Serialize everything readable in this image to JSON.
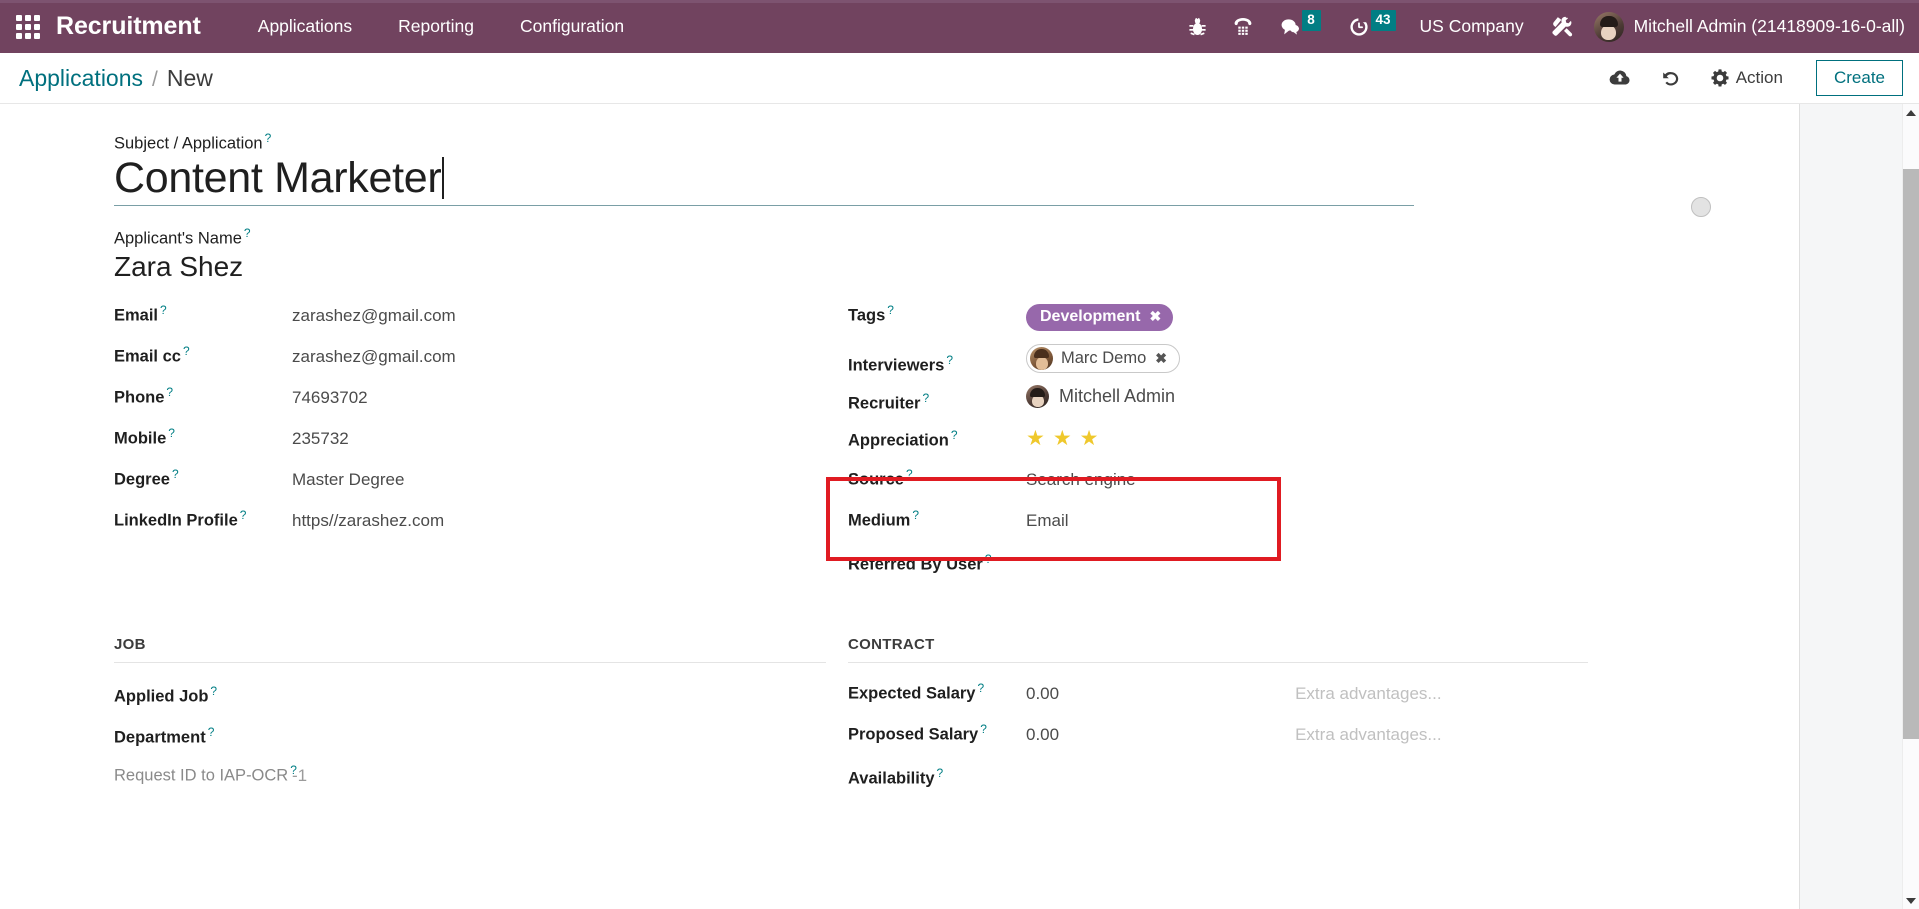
{
  "navbar": {
    "apps_icon": "apps-grid-icon",
    "brand": "Recruitment",
    "menus": [
      {
        "label": "Applications"
      },
      {
        "label": "Reporting"
      },
      {
        "label": "Configuration"
      }
    ],
    "sys_icons": [
      {
        "name": "bug-icon",
        "badge": null
      },
      {
        "name": "phone-dialpad-icon",
        "badge": null
      },
      {
        "name": "messages-icon",
        "badge": "8"
      },
      {
        "name": "activities-clock-icon",
        "badge": "43"
      }
    ],
    "company": "US Company",
    "tools_icon": "wrench-tools-icon",
    "user": "Mitchell Admin (21418909-16-0-all)",
    "colors": {
      "background": "#71435F",
      "badge": "#017e84"
    }
  },
  "control_panel": {
    "breadcrumb_root": "Applications",
    "breadcrumb_sep": "/",
    "breadcrumb_current": "New",
    "save_icon": "cloud-upload-icon",
    "discard_icon": "undo-icon",
    "action_icon": "gear-icon",
    "action_label": "Action",
    "create_label": "Create",
    "colors": {
      "link": "#00707e",
      "accent": "#00707e"
    }
  },
  "form": {
    "title_label": "Subject / Application",
    "title_value": "Content Marketer",
    "applicant_label": "Applicant's Name",
    "applicant_value": "Zara Shez",
    "kanban_state": "kanban-state-grey",
    "left_fields": [
      {
        "label": "Email",
        "value": "zarashez@gmail.com"
      },
      {
        "label": "Email cc",
        "value": "zarashez@gmail.com"
      },
      {
        "label": "Phone",
        "value": "74693702"
      },
      {
        "label": "Mobile",
        "value": "235732"
      },
      {
        "label": "Degree",
        "value": "Master Degree"
      },
      {
        "label": "LinkedIn Profile",
        "value": "https//zarashez.com"
      }
    ],
    "right_fields": {
      "tags_label": "Tags",
      "tag_value": "Development",
      "tag_remove": "✖",
      "tag_color": "#9768ab",
      "interviewers_label": "Interviewers",
      "interviewer_value": "Marc Demo",
      "interviewer_remove": "✖",
      "recruiter_label": "Recruiter",
      "recruiter_value": "Mitchell Admin",
      "appreciation_label": "Appreciation",
      "appreciation_stars": 3,
      "star_glyph": "★",
      "source_label": "Source",
      "source_value": "Search engine",
      "medium_label": "Medium",
      "medium_value": "Email",
      "referred_label": "Referred By User",
      "referred_value": ""
    },
    "job_section": {
      "title": "JOB",
      "applied_job_label": "Applied Job",
      "applied_job_value": "",
      "department_label": "Department",
      "department_value": "",
      "request_id_label": "Request ID to IAP-OCR",
      "request_id_value": "-1"
    },
    "contract_section": {
      "title": "CONTRACT",
      "expected_salary_label": "Expected Salary",
      "expected_salary_value": "0.00",
      "expected_extra_placeholder": "Extra advantages...",
      "proposed_salary_label": "Proposed Salary",
      "proposed_salary_value": "0.00",
      "proposed_extra_placeholder": "Extra advantages...",
      "availability_label": "Availability",
      "availability_value": ""
    },
    "highlight": {
      "color": "#e01b22",
      "target": "source-and-medium-fields"
    }
  },
  "scrollbar": {
    "up_arrow": "scroll-up-arrow",
    "down_arrow": "scroll-down-arrow"
  }
}
